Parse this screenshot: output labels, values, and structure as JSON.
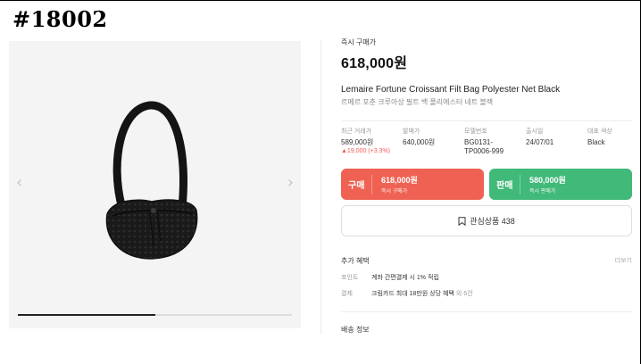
{
  "listing_id": "#18002",
  "gallery": {
    "prev_arrow": "‹",
    "next_arrow": "›",
    "progress": 0.5
  },
  "product": {
    "instant_buy_label": "즉시 구매가",
    "price": "618,000원",
    "name_en": "Lemaire Fortune Croissant Filt Bag Polyester Net Black",
    "name_ko": "르메르 포춘 크루아상 필트 백 폴리에스터 네트 블랙"
  },
  "specs": [
    {
      "label": "최근 거래가",
      "value": "589,000원",
      "change": "▲19,000 (+3.3%)"
    },
    {
      "label": "발매가",
      "value": "640,000원"
    },
    {
      "label": "모델번호",
      "value": "BG0131-\nTP0006-999"
    },
    {
      "label": "출시일",
      "value": "24/07/01"
    },
    {
      "label": "대표 색상",
      "value": "Black"
    }
  ],
  "buy_button": {
    "label": "구매",
    "price": "618,000원",
    "sub": "즉시 구매가"
  },
  "sell_button": {
    "label": "판매",
    "price": "580,000원",
    "sub": "즉시 판매가"
  },
  "wish": {
    "label": "관심상품 438"
  },
  "benefits": {
    "title": "추가 혜택",
    "more": "더보기",
    "point_label": "포인트",
    "point_value": "계좌 간편결제 시 1% 적립",
    "payment_label": "결제",
    "payment_value": "크림카드 최대 18만원 상당 혜택",
    "payment_suffix": "외 6건"
  },
  "shipping": {
    "title": "배송 정보"
  },
  "colors": {
    "buy": "#ef6253",
    "sell": "#41b979",
    "change_up": "#ef5b52"
  },
  "icons": {
    "bookmark": "bookmark-icon",
    "prev": "chevron-left-icon",
    "next": "chevron-right-icon"
  }
}
